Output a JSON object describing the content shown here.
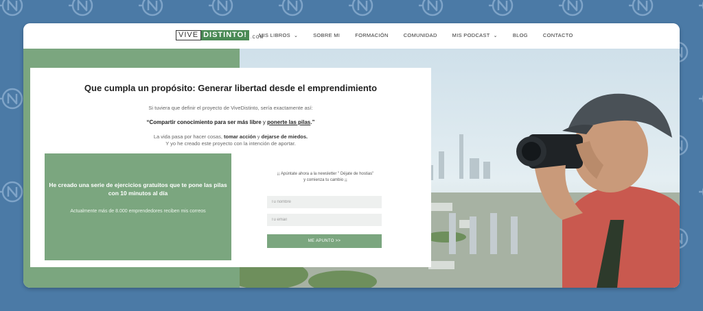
{
  "brand": {
    "logo_part1": "VIVE",
    "logo_part2": "DISTINTO!",
    "logo_tld": ".COM"
  },
  "nav": {
    "items": [
      {
        "label": "MIS LIBROS",
        "dropdown": true
      },
      {
        "label": "SOBRE MI",
        "dropdown": false
      },
      {
        "label": "FORMACIÓN",
        "dropdown": false
      },
      {
        "label": "COMUNIDAD",
        "dropdown": false
      },
      {
        "label": "MIS PODCAST",
        "dropdown": true
      },
      {
        "label": "BLOG",
        "dropdown": false
      },
      {
        "label": "CONTACTO",
        "dropdown": false
      }
    ],
    "chevron": "⌄"
  },
  "hero": {
    "headline": "Que cumpla un propósito: Generar libertad desde el emprendimiento",
    "intro": "Si tuviera que definir el proyecto de ViveDistinto, sería exactamente así:",
    "quote_part1": "“Compartir conocimiento para ser más libre",
    "quote_part2": " y ",
    "quote_part3": "ponerte las pilas",
    "quote_part4": ".”",
    "line1_a": "La vida pasa por hacer cosas, ",
    "line1_b": "tomar acción",
    "line1_c": " y ",
    "line1_d": "dejarse de miedos.",
    "line2": "Y yo he creado este proyecto con la intención de aportar."
  },
  "optin": {
    "title": "He creado una serie de ejercicios gratuitos que te pone las pilas con 10 minutos al día",
    "subtitle": "Actualmente más de 8.000 emprendedores reciben mis correos",
    "form_intro_line1": "¡¡ Apúntate ahora a la newsletter \" Déjate de hostias\"",
    "form_intro_line2": "y comienza tu cambio ¡¡",
    "name_placeholder": "Tu nombre",
    "email_placeholder": "Tu email",
    "submit_label": "ME APUNTO >>"
  },
  "colors": {
    "background": "#4b7aa6",
    "accent_green": "#7ba67f",
    "logo_green": "#4a8a55"
  },
  "icons": {
    "pattern_icon": "n-circle-logo-icon",
    "chevron": "chevron-down-icon"
  }
}
